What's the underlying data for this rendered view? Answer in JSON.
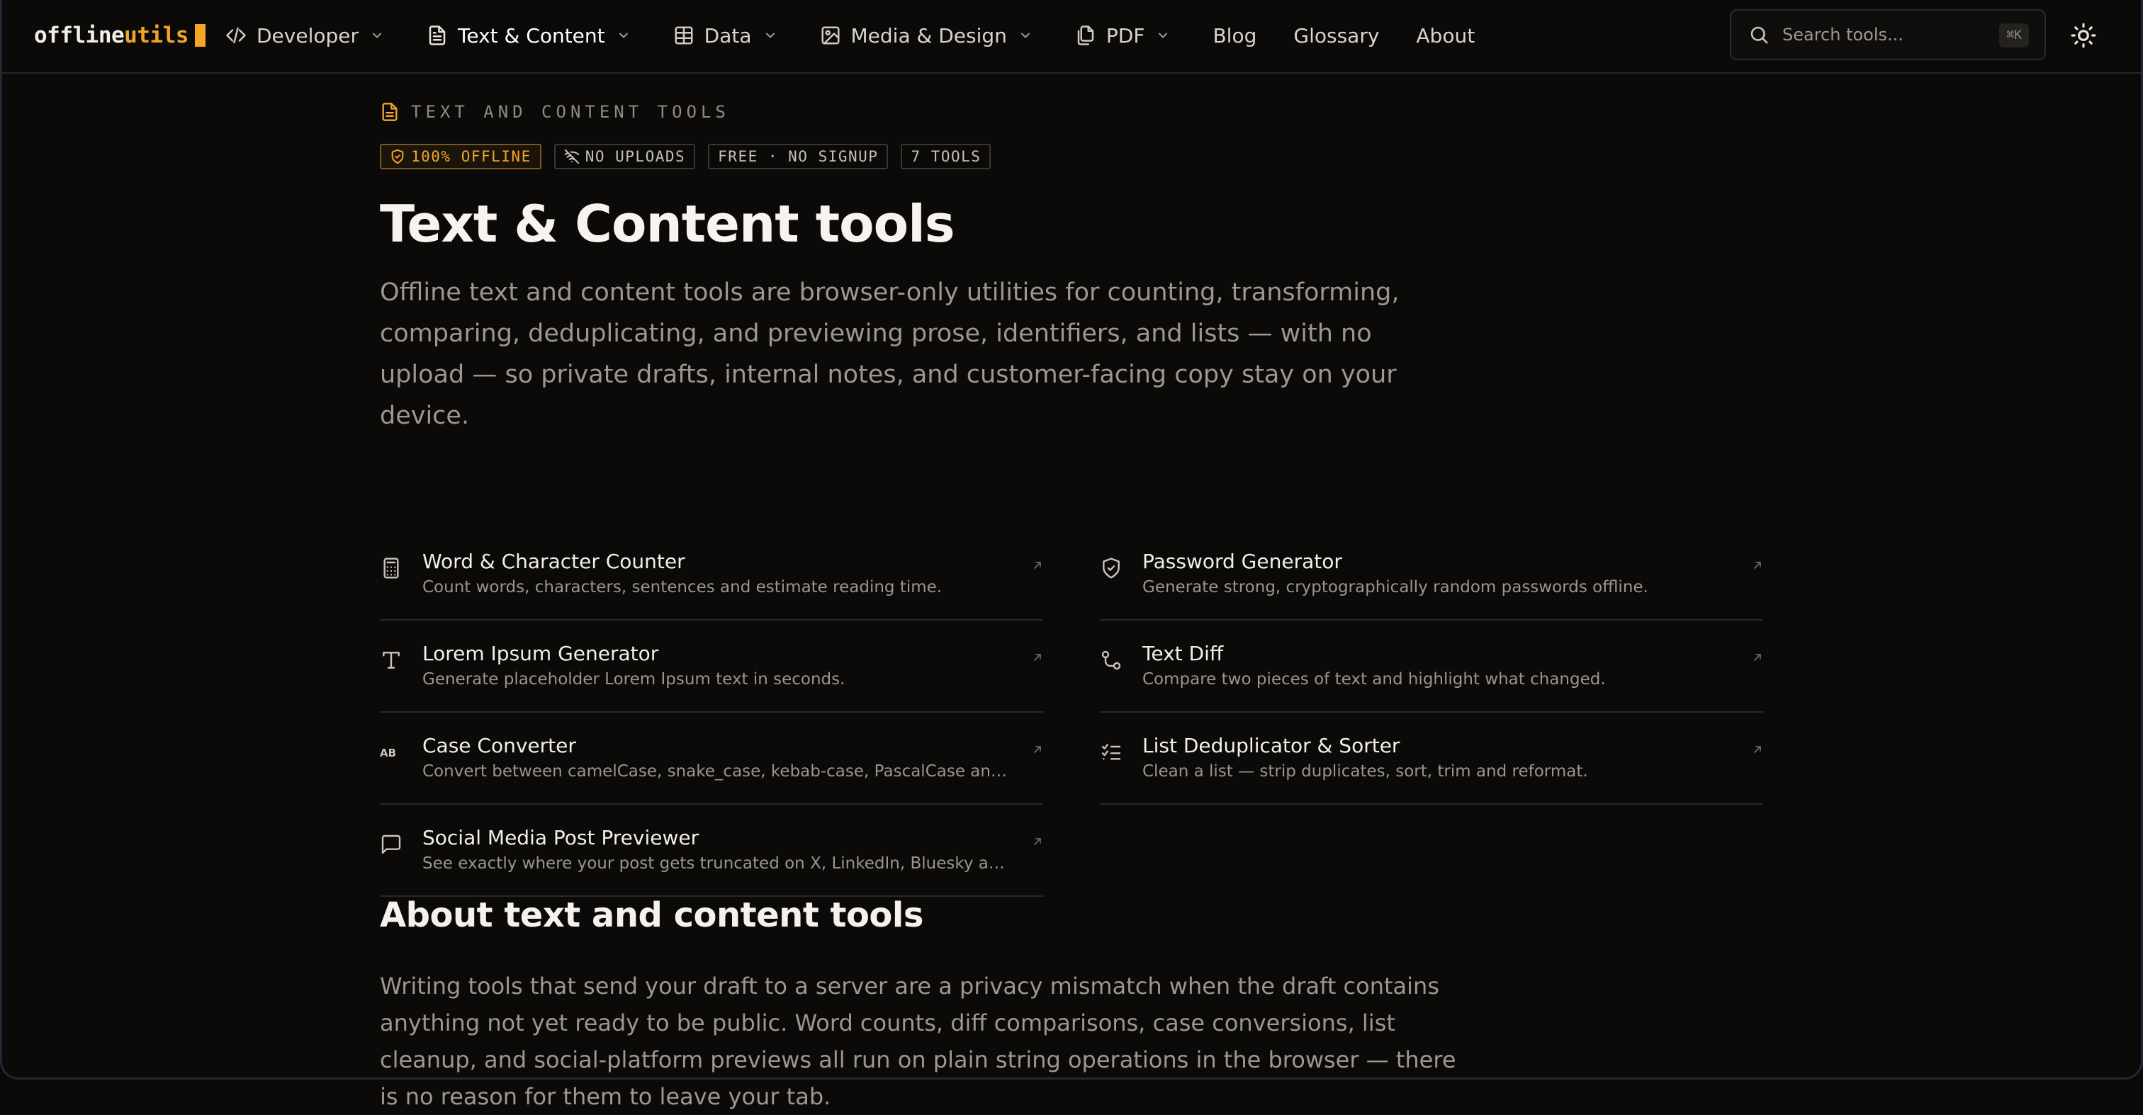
{
  "logo": {
    "part1": "offline",
    "part2": "utils"
  },
  "nav": {
    "items": [
      {
        "label": "Developer"
      },
      {
        "label": "Text & Content"
      },
      {
        "label": "Data"
      },
      {
        "label": "Media & Design"
      },
      {
        "label": "PDF"
      }
    ],
    "links": [
      {
        "label": "Blog"
      },
      {
        "label": "Glossary"
      },
      {
        "label": "About"
      }
    ],
    "active_item": "Text & Content"
  },
  "search": {
    "placeholder": "Search tools...",
    "shortcut": "⌘K"
  },
  "hero": {
    "eyebrow": "TEXT AND CONTENT TOOLS",
    "badges": [
      "100% OFFLINE",
      "NO UPLOADS",
      "FREE · NO SIGNUP",
      "7 TOOLS"
    ],
    "title": "Text & Content tools",
    "lede": "Offline text and content tools are browser-only utilities for counting, transforming, comparing, deduplicating, and previewing prose, identifiers, and lists — with no upload — so private drafts, internal notes, and customer-facing copy stay on your device."
  },
  "tools": [
    {
      "name": "Word & Character Counter",
      "desc": "Count words, characters, sentences and estimate reading time.",
      "icon": "calculator-icon"
    },
    {
      "name": "Password Generator",
      "desc": "Generate strong, cryptographically random passwords offline.",
      "icon": "shield-icon"
    },
    {
      "name": "Lorem Ipsum Generator",
      "desc": "Generate placeholder Lorem Ipsum text in seconds.",
      "icon": "type-icon"
    },
    {
      "name": "Text Diff",
      "desc": "Compare two pieces of text and highlight what changed.",
      "icon": "git-compare-icon"
    },
    {
      "name": "Case Converter",
      "desc": "Convert between camelCase, snake_case, kebab-case, PascalCase and more.",
      "icon": "case-sensitive-icon"
    },
    {
      "name": "List Deduplicator & Sorter",
      "desc": "Clean a list — strip duplicates, sort, trim and reformat.",
      "icon": "list-checks-icon"
    },
    {
      "name": "Social Media Post Previewer",
      "desc": "See exactly where your post gets truncated on X, LinkedIn, Bluesky and You...",
      "icon": "message-square-icon"
    }
  ],
  "about": {
    "heading": "About text and content tools",
    "body": "Writing tools that send your draft to a server are a privacy mismatch when the draft contains anything not yet ready to be public. Word counts, diff comparisons, case conversions, list cleanup, and social-platform previews all run on plain string operations in the browser — there is no reason for them to leave your tab."
  },
  "colors": {
    "background": "#0b0a09",
    "accent": "#f5a524",
    "text": "#f2efe9",
    "muted": "#9c978f",
    "border": "#2a2826"
  }
}
